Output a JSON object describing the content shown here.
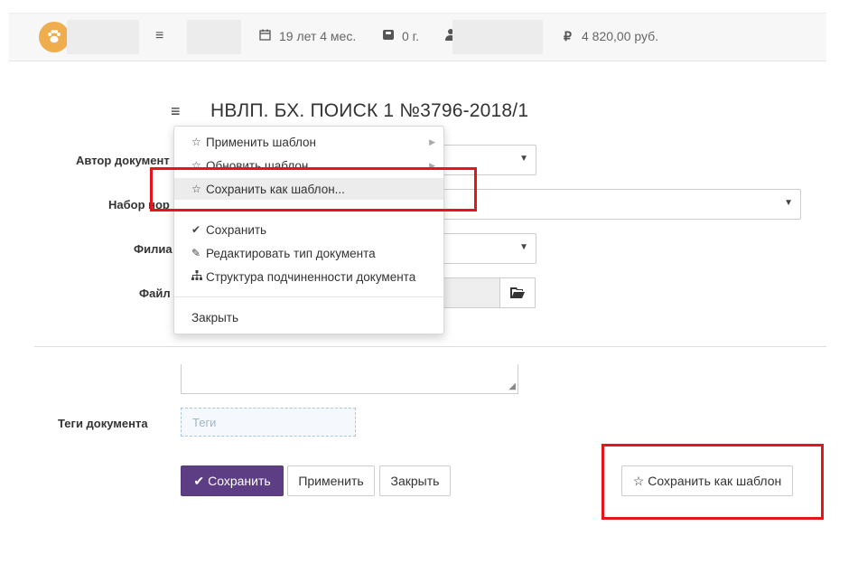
{
  "topbar": {
    "age": "19 лет 4 мес.",
    "seniority": "0 г.",
    "balance_currency": "₽",
    "balance": "4 820,00 руб."
  },
  "page": {
    "title": "НВЛП. БХ. ПОИСК 1 №3796-2018/1"
  },
  "form": {
    "author_label": "Автор документ",
    "norms_label": "Набор нор",
    "branch_label": "Филиа",
    "file_label": "Файл",
    "tags_label": "Теги документа",
    "tags_placeholder": "Теги"
  },
  "menu": {
    "items": [
      {
        "label": "Применить шаблон",
        "icon": "star-outline-icon"
      },
      {
        "label": "Обновить шаблон",
        "icon": "star-outline-icon"
      },
      {
        "label": "Сохранить как шаблон...",
        "icon": "star-outline-icon"
      },
      {
        "label": "Сохранить",
        "icon": "check-icon"
      },
      {
        "label": "Редактировать тип документа",
        "icon": "edit-icon"
      },
      {
        "label": "Структура подчиненности документа",
        "icon": "sitemap-icon"
      },
      {
        "label": "Закрыть"
      }
    ]
  },
  "buttons": {
    "save": "Сохранить",
    "apply": "Применить",
    "close": "Закрыть",
    "save_template": "Сохранить как шаблон"
  },
  "colors": {
    "primary": "#5d3e85",
    "highlight": "#e8141c",
    "avatar": "#f0ad4e"
  }
}
